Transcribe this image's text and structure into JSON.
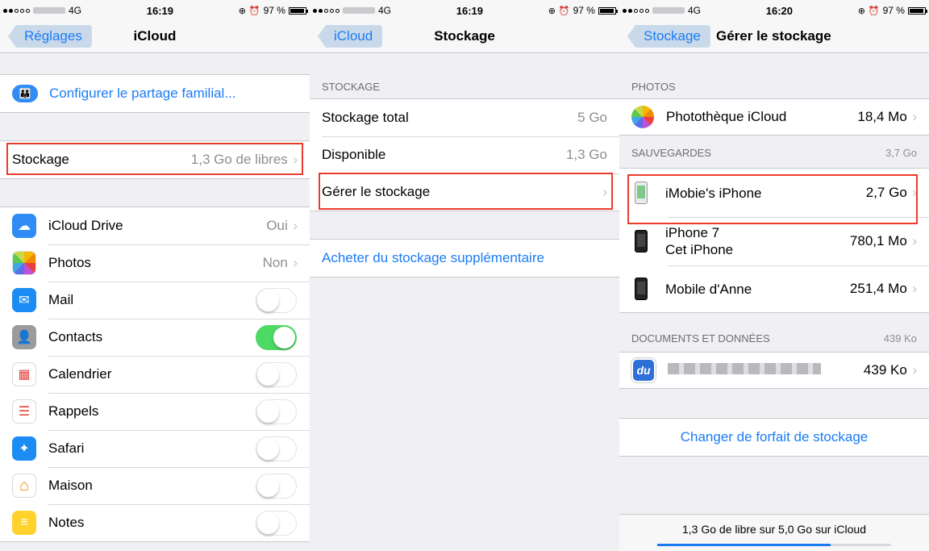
{
  "status": {
    "s1": {
      "carrier": "4G",
      "time": "16:19",
      "battery": "97 %"
    },
    "s2": {
      "carrier": "4G",
      "time": "16:19",
      "battery": "97 %"
    },
    "s3": {
      "carrier": "4G",
      "time": "16:20",
      "battery": "97 %"
    }
  },
  "screen1": {
    "back": "Réglages",
    "title": "iCloud",
    "family": "Configurer le partage familial...",
    "storage": {
      "label": "Stockage",
      "value": "1,3 Go de libres"
    },
    "apps": [
      {
        "label": "iCloud Drive",
        "value": "Oui",
        "icon": "cloud-icon",
        "color": "#2f8cf5"
      },
      {
        "label": "Photos",
        "value": "Non",
        "icon": "photos-icon",
        "color": "#ffffff"
      },
      {
        "label": "Mail",
        "toggle": false,
        "icon": "mail-icon",
        "color": "#1b8cf3"
      },
      {
        "label": "Contacts",
        "toggle": true,
        "icon": "contacts-icon",
        "color": "#9b9b9b"
      },
      {
        "label": "Calendrier",
        "toggle": false,
        "icon": "calendar-icon",
        "color": "#ffffff"
      },
      {
        "label": "Rappels",
        "toggle": false,
        "icon": "reminders-icon",
        "color": "#ffffff"
      },
      {
        "label": "Safari",
        "toggle": false,
        "icon": "safari-icon",
        "color": "#1b8cf3"
      },
      {
        "label": "Maison",
        "toggle": false,
        "icon": "home-icon",
        "color": "#ffffff"
      },
      {
        "label": "Notes",
        "toggle": false,
        "icon": "notes-icon",
        "color": "#ffd22e"
      }
    ]
  },
  "screen2": {
    "back": "iCloud",
    "title": "Stockage",
    "header": "STOCKAGE",
    "rows": [
      {
        "label": "Stockage total",
        "value": "5 Go"
      },
      {
        "label": "Disponible",
        "value": "1,3 Go"
      },
      {
        "label": "Gérer le stockage",
        "value": ""
      }
    ],
    "buy": "Acheter du stockage supplémentaire"
  },
  "screen3": {
    "back": "Stockage",
    "title": "Gérer le stockage",
    "photos_header": "PHOTOS",
    "photos_row": {
      "label": "Photothèque iCloud",
      "value": "18,4 Mo"
    },
    "backups_header": "SAUVEGARDES",
    "backups_total": "3,7 Go",
    "backups": [
      {
        "line1": "iMobie's iPhone",
        "line2": "",
        "value": "2,7 Go"
      },
      {
        "line1": "iPhone 7",
        "line2": "Cet iPhone",
        "value": "780,1 Mo"
      },
      {
        "line1": "Mobile d'Anne",
        "line2": "",
        "value": "251,4 Mo"
      }
    ],
    "docs_header": "DOCUMENTS ET DONNÉES",
    "docs_total": "439 Ko",
    "docs_row": {
      "icon_text": "du",
      "value": "439 Ko"
    },
    "change_plan": "Changer de forfait de stockage",
    "footer": "1,3 Go de libre sur 5,0 Go sur iCloud",
    "used_fraction": 0.74
  }
}
